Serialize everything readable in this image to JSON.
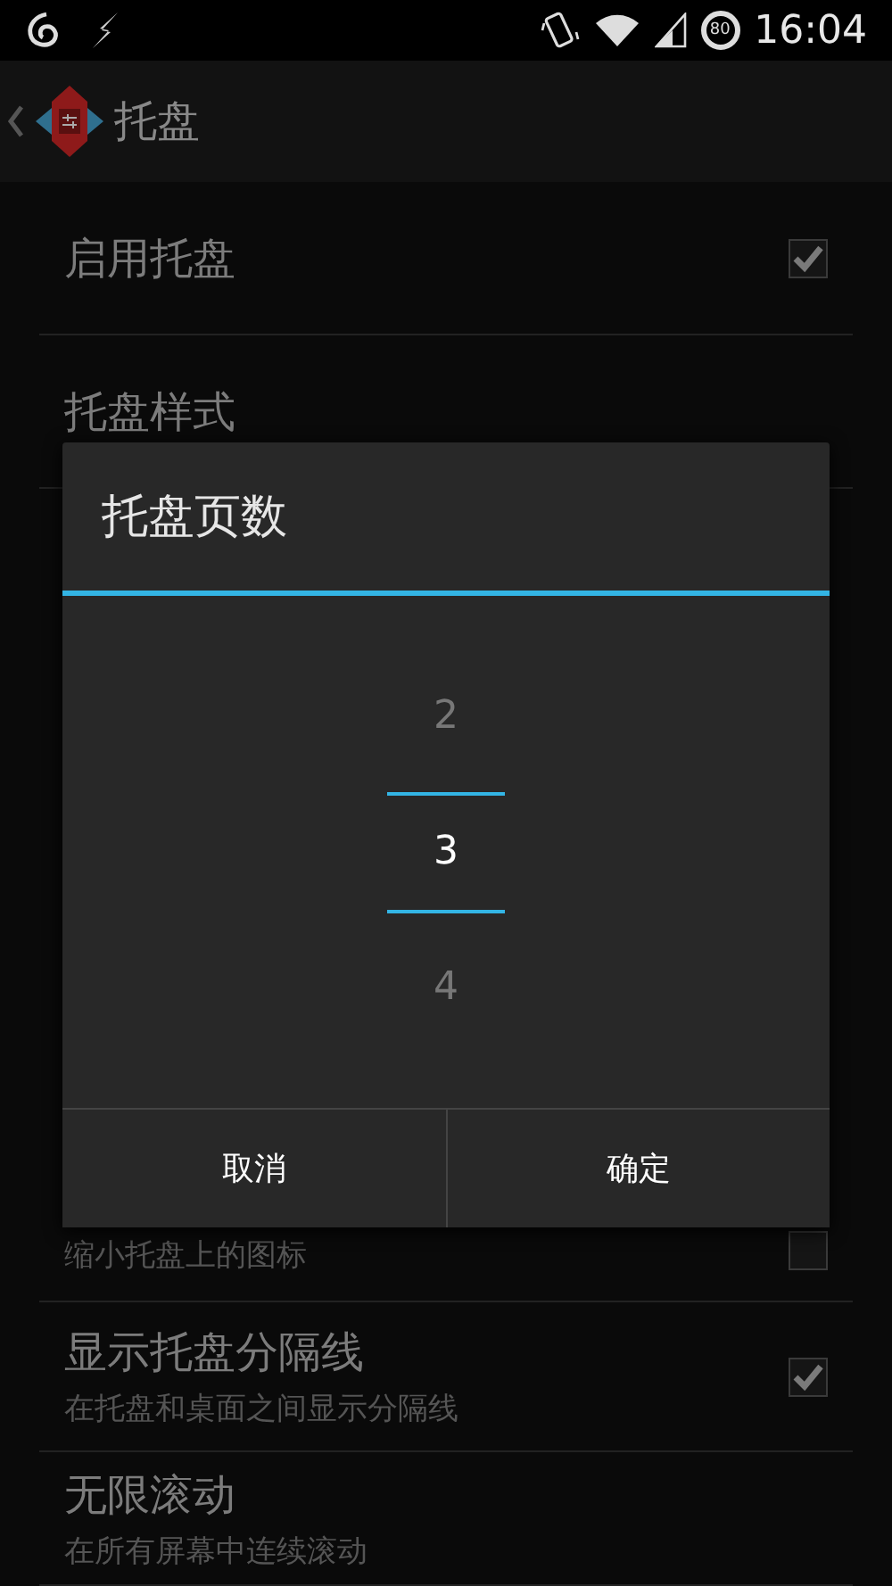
{
  "status_bar": {
    "time": "16:04",
    "battery": "80"
  },
  "app_bar": {
    "title": "托盘"
  },
  "preferences": [
    {
      "kind": "checkbox",
      "title": "启用托盘",
      "checked": true
    },
    {
      "kind": "plain",
      "title": "托盘样式"
    },
    {
      "kind": "checkbox",
      "summary": "缩小托盘上的图标",
      "checked": false
    },
    {
      "kind": "checkbox",
      "title": "显示托盘分隔线",
      "summary": "在托盘和桌面之间显示分隔线",
      "checked": true
    },
    {
      "kind": "plain",
      "title": "无限滚动",
      "summary": "在所有屏幕中连续滚动"
    }
  ],
  "dialog": {
    "title": "托盘页数",
    "picker": [
      {
        "text": "2",
        "selected": false
      },
      {
        "text": "3",
        "selected": true
      },
      {
        "text": "4",
        "selected": false
      }
    ],
    "buttons": [
      {
        "label": "取消"
      },
      {
        "label": "确定"
      }
    ]
  }
}
